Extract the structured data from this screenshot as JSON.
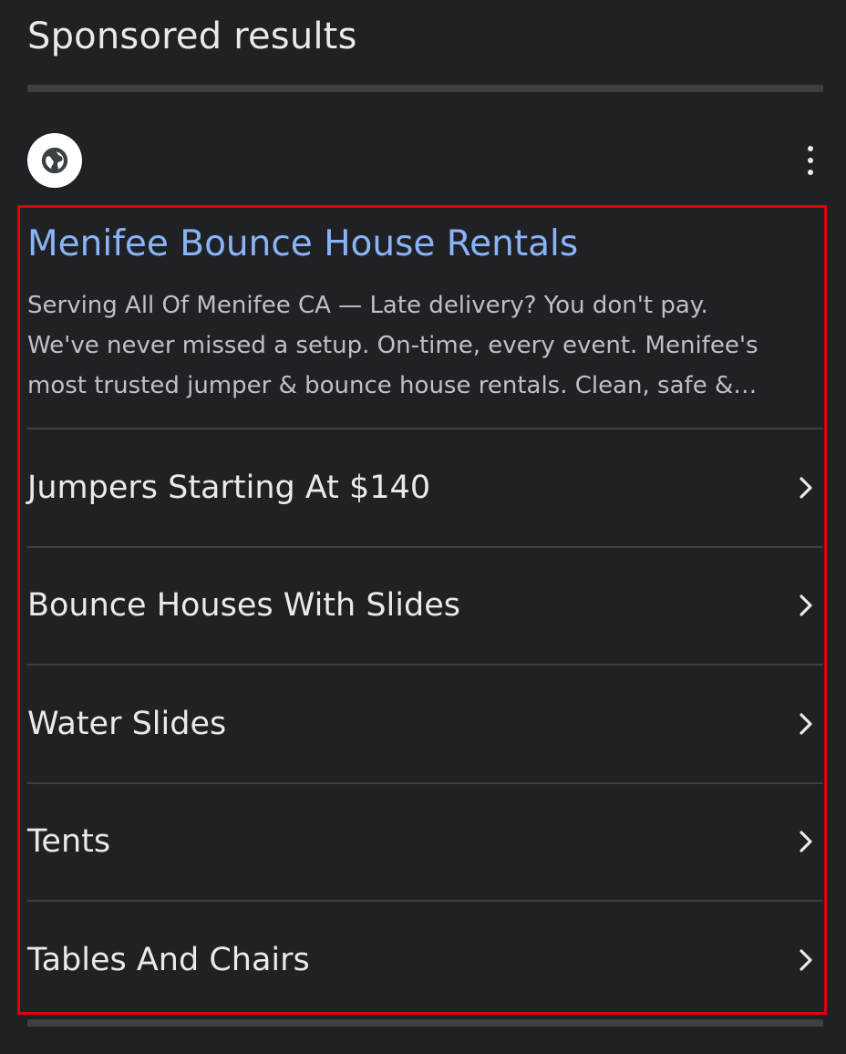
{
  "header": {
    "title": "Sponsored results"
  },
  "site": {
    "icon": "globe-icon"
  },
  "ad": {
    "title": "Menifee Bounce House Rentals",
    "description_lines": [
      "Serving All Of Menifee CA — Late delivery? You don't pay.",
      "We've never missed a setup. On-time, every event. Menifee's",
      "most trusted jumper & bounce house rentals. Clean, safe &…"
    ],
    "sitelinks": [
      {
        "label": "Jumpers Starting At $140"
      },
      {
        "label": "Bounce Houses With Slides"
      },
      {
        "label": "Water Slides"
      },
      {
        "label": "Tents"
      },
      {
        "label": "Tables And Chairs"
      }
    ]
  },
  "colors": {
    "background": "#202124",
    "title_link": "#8ab4f8",
    "highlight_border": "#e0000a"
  }
}
